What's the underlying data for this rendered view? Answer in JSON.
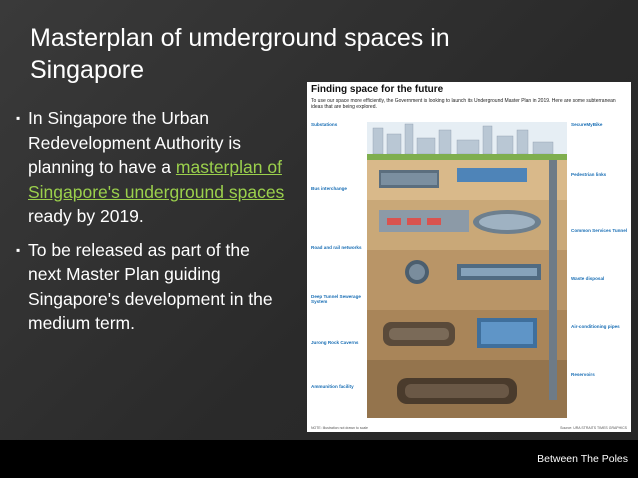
{
  "slide": {
    "title": "Masterplan of umderground spaces in Singapore",
    "bullets": [
      {
        "before": "In Singapore the Urban Redevelopment Authority is planning to have a ",
        "link": "masterplan of Singapore's underground spaces",
        "after": " ready by 2019."
      },
      {
        "text": "To be released as part of the next Master Plan guiding Singapore's development in the medium term."
      }
    ],
    "bullet_glyph": "▪",
    "link_color": "#9bd04c"
  },
  "infographic": {
    "title": "Finding space for the future",
    "subtitle": "To use our space more efficiently, the Government is looking to launch its Underground Master Plan in 2019. Here are some subterranean ideas that are being explored.",
    "left_labels": [
      {
        "label": "Substations"
      },
      {
        "label": "Bus interchange"
      },
      {
        "label": "Road and rail networks"
      },
      {
        "label": "Deep Tunnel Sewerage System"
      },
      {
        "label": "Jurong Rock Caverns"
      },
      {
        "label": "Ammunition facility"
      }
    ],
    "right_labels": [
      {
        "label": "SecureMyBike"
      },
      {
        "label": "Pedestrian links"
      },
      {
        "label": "Common Services Tunnel"
      },
      {
        "label": "Waste disposal"
      },
      {
        "label": "Air-conditioning pipes"
      },
      {
        "label": "Reservoirs"
      }
    ],
    "foot_left": "NOTE: Illustration not drawn to scale",
    "foot_right": "Source: URA  STRAITS TIMES GRAPHICS"
  },
  "footer": {
    "label": "Between The Poles"
  }
}
